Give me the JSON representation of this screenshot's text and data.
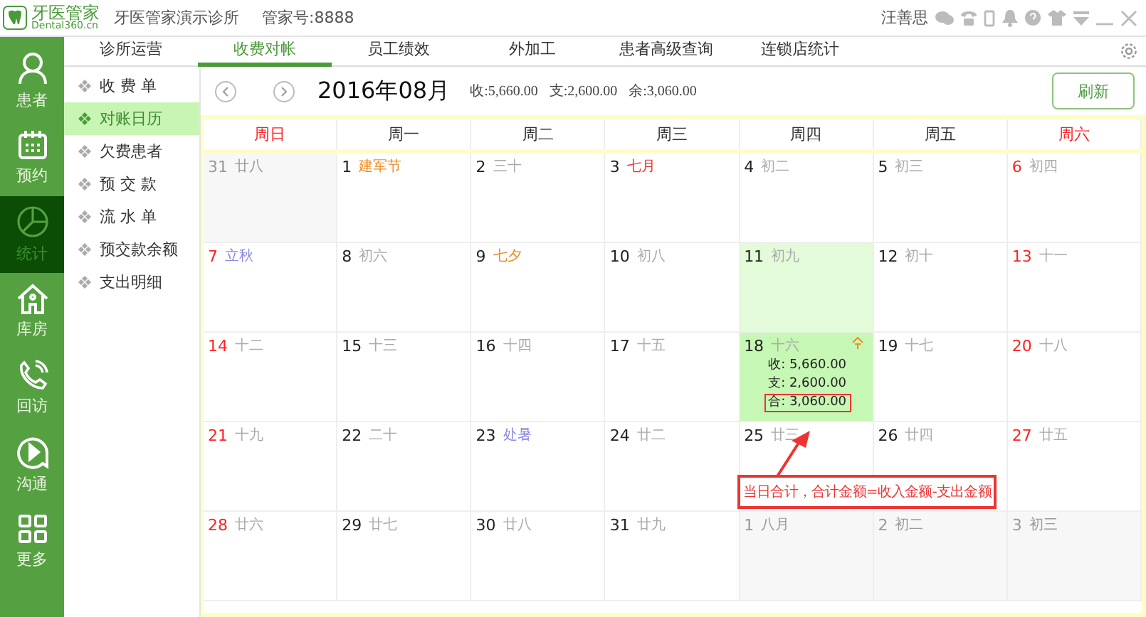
{
  "titlebar": {
    "logo_text": "牙医管家",
    "logo_sub": "Dental360.cn",
    "clinic": "牙医管家演示诊所",
    "account": "管家号:8888",
    "user": "汪善思"
  },
  "rail": [
    {
      "label": "患者",
      "selected": false
    },
    {
      "label": "预约",
      "selected": false
    },
    {
      "label": "统计",
      "selected": true
    },
    {
      "label": "库房",
      "selected": false
    },
    {
      "label": "回访",
      "selected": false
    },
    {
      "label": "沟通",
      "selected": false
    },
    {
      "label": "更多",
      "selected": false
    }
  ],
  "tabs": [
    {
      "label": "诊所运营",
      "selected": false
    },
    {
      "label": "收费对帐",
      "selected": true
    },
    {
      "label": "员工绩效",
      "selected": false
    },
    {
      "label": "外加工",
      "selected": false
    },
    {
      "label": "患者高级查询",
      "selected": false
    },
    {
      "label": "连锁店统计",
      "selected": false
    }
  ],
  "submenu": [
    {
      "label": "收 费 单",
      "selected": false
    },
    {
      "label": "对账日历",
      "selected": true
    },
    {
      "label": "欠费患者",
      "selected": false
    },
    {
      "label": "预 交 款",
      "selected": false
    },
    {
      "label": "流 水 单",
      "selected": false
    },
    {
      "label": "预交款余额",
      "selected": false
    },
    {
      "label": "支出明细",
      "selected": false
    }
  ],
  "month": {
    "title": "2016年08月",
    "income": "收:5,660.00",
    "expense": "支:2,600.00",
    "balance": "余:3,060.00",
    "refresh": "刷新"
  },
  "weekdays": [
    {
      "label": "周日",
      "weekend": true
    },
    {
      "label": "周一",
      "weekend": false
    },
    {
      "label": "周二",
      "weekend": false
    },
    {
      "label": "周三",
      "weekend": false
    },
    {
      "label": "周四",
      "weekend": false
    },
    {
      "label": "周五",
      "weekend": false
    },
    {
      "label": "周六",
      "weekend": true
    }
  ],
  "weeks": [
    [
      {
        "day": "31",
        "lunar": "廿八",
        "in_month": false,
        "highlighted": false,
        "selected": false
      },
      {
        "day": "1",
        "lunar": "建军节",
        "kind": "festival",
        "in_month": true,
        "weekend": false,
        "highlighted": false,
        "selected": false
      },
      {
        "day": "2",
        "lunar": "三十",
        "kind": "plain",
        "in_month": true,
        "weekend": false,
        "highlighted": false,
        "selected": false
      },
      {
        "day": "3",
        "lunar": "七月",
        "kind": "month",
        "in_month": true,
        "weekend": false,
        "highlighted": false,
        "selected": false
      },
      {
        "day": "4",
        "lunar": "初二",
        "kind": "plain",
        "in_month": true,
        "weekend": false,
        "highlighted": false,
        "selected": false
      },
      {
        "day": "5",
        "lunar": "初三",
        "kind": "plain",
        "in_month": true,
        "weekend": false,
        "highlighted": false,
        "selected": false
      },
      {
        "day": "6",
        "lunar": "初四",
        "kind": "plain",
        "in_month": true,
        "weekend": true,
        "highlighted": false,
        "selected": false
      }
    ],
    [
      {
        "day": "7",
        "lunar": "立秋",
        "kind": "term",
        "in_month": true,
        "weekend": true,
        "highlighted": false,
        "selected": false
      },
      {
        "day": "8",
        "lunar": "初六",
        "kind": "plain",
        "in_month": true,
        "weekend": false,
        "highlighted": false,
        "selected": false
      },
      {
        "day": "9",
        "lunar": "七夕",
        "kind": "festival",
        "in_month": true,
        "weekend": false,
        "highlighted": false,
        "selected": false
      },
      {
        "day": "10",
        "lunar": "初八",
        "kind": "plain",
        "in_month": true,
        "weekend": false,
        "highlighted": false,
        "selected": false
      },
      {
        "day": "11",
        "lunar": "初九",
        "kind": "plain",
        "in_month": true,
        "weekend": false,
        "highlighted": true,
        "selected": false
      },
      {
        "day": "12",
        "lunar": "初十",
        "kind": "plain",
        "in_month": true,
        "weekend": false,
        "highlighted": false,
        "selected": false
      },
      {
        "day": "13",
        "lunar": "十一",
        "kind": "plain",
        "in_month": true,
        "weekend": true,
        "highlighted": false,
        "selected": false
      }
    ],
    [
      {
        "day": "14",
        "lunar": "十二",
        "kind": "plain",
        "in_month": true,
        "weekend": true,
        "highlighted": false,
        "selected": false
      },
      {
        "day": "15",
        "lunar": "十三",
        "kind": "plain",
        "in_month": true,
        "weekend": false,
        "highlighted": false,
        "selected": false
      },
      {
        "day": "16",
        "lunar": "十四",
        "kind": "plain",
        "in_month": true,
        "weekend": false,
        "highlighted": false,
        "selected": false
      },
      {
        "day": "17",
        "lunar": "十五",
        "kind": "plain",
        "in_month": true,
        "weekend": false,
        "highlighted": false,
        "selected": false
      },
      {
        "day": "18",
        "lunar": "十六",
        "kind": "plain",
        "in_month": true,
        "weekend": false,
        "selected": true,
        "amounts": [
          {
            "text": "收: 5,660.00",
            "boxed": false
          },
          {
            "text": "支: 2,600.00",
            "boxed": false
          },
          {
            "text": "合: 3,060.00",
            "boxed": true
          }
        ]
      },
      {
        "day": "19",
        "lunar": "十七",
        "kind": "plain",
        "in_month": true,
        "weekend": false,
        "highlighted": false,
        "selected": false
      },
      {
        "day": "20",
        "lunar": "十八",
        "kind": "plain",
        "in_month": true,
        "weekend": true,
        "highlighted": false,
        "selected": false
      }
    ],
    [
      {
        "day": "21",
        "lunar": "十九",
        "kind": "plain",
        "in_month": true,
        "weekend": true,
        "highlighted": false,
        "selected": false
      },
      {
        "day": "22",
        "lunar": "二十",
        "kind": "plain",
        "in_month": true,
        "weekend": false,
        "highlighted": false,
        "selected": false
      },
      {
        "day": "23",
        "lunar": "处暑",
        "kind": "term",
        "in_month": true,
        "weekend": false,
        "highlighted": false,
        "selected": false
      },
      {
        "day": "24",
        "lunar": "廿二",
        "kind": "plain",
        "in_month": true,
        "weekend": false,
        "highlighted": false,
        "selected": false
      },
      {
        "day": "25",
        "lunar": "廿三",
        "kind": "plain",
        "in_month": true,
        "weekend": false,
        "highlighted": false,
        "selected": false
      },
      {
        "day": "26",
        "lunar": "廿四",
        "kind": "plain",
        "in_month": true,
        "weekend": false,
        "highlighted": false,
        "selected": false
      },
      {
        "day": "27",
        "lunar": "廿五",
        "kind": "plain",
        "in_month": true,
        "weekend": true,
        "highlighted": false,
        "selected": false
      }
    ],
    [
      {
        "day": "28",
        "lunar": "廿六",
        "kind": "plain",
        "in_month": true,
        "weekend": true,
        "highlighted": false,
        "selected": false
      },
      {
        "day": "29",
        "lunar": "廿七",
        "kind": "plain",
        "in_month": true,
        "weekend": false,
        "highlighted": false,
        "selected": false
      },
      {
        "day": "30",
        "lunar": "廿八",
        "kind": "plain",
        "in_month": true,
        "weekend": false,
        "highlighted": false,
        "selected": false
      },
      {
        "day": "31",
        "lunar": "廿九",
        "kind": "plain",
        "in_month": true,
        "weekend": false,
        "highlighted": false,
        "selected": false
      },
      {
        "day": "1",
        "lunar": "八月",
        "in_month": false,
        "highlighted": false,
        "selected": false
      },
      {
        "day": "2",
        "lunar": "初二",
        "in_month": false,
        "highlighted": false,
        "selected": false
      },
      {
        "day": "3",
        "lunar": "初三",
        "in_month": false,
        "highlighted": false,
        "selected": false
      }
    ]
  ],
  "annotation": {
    "text": "当日合计，合计金额=收入金额-支出金额"
  }
}
